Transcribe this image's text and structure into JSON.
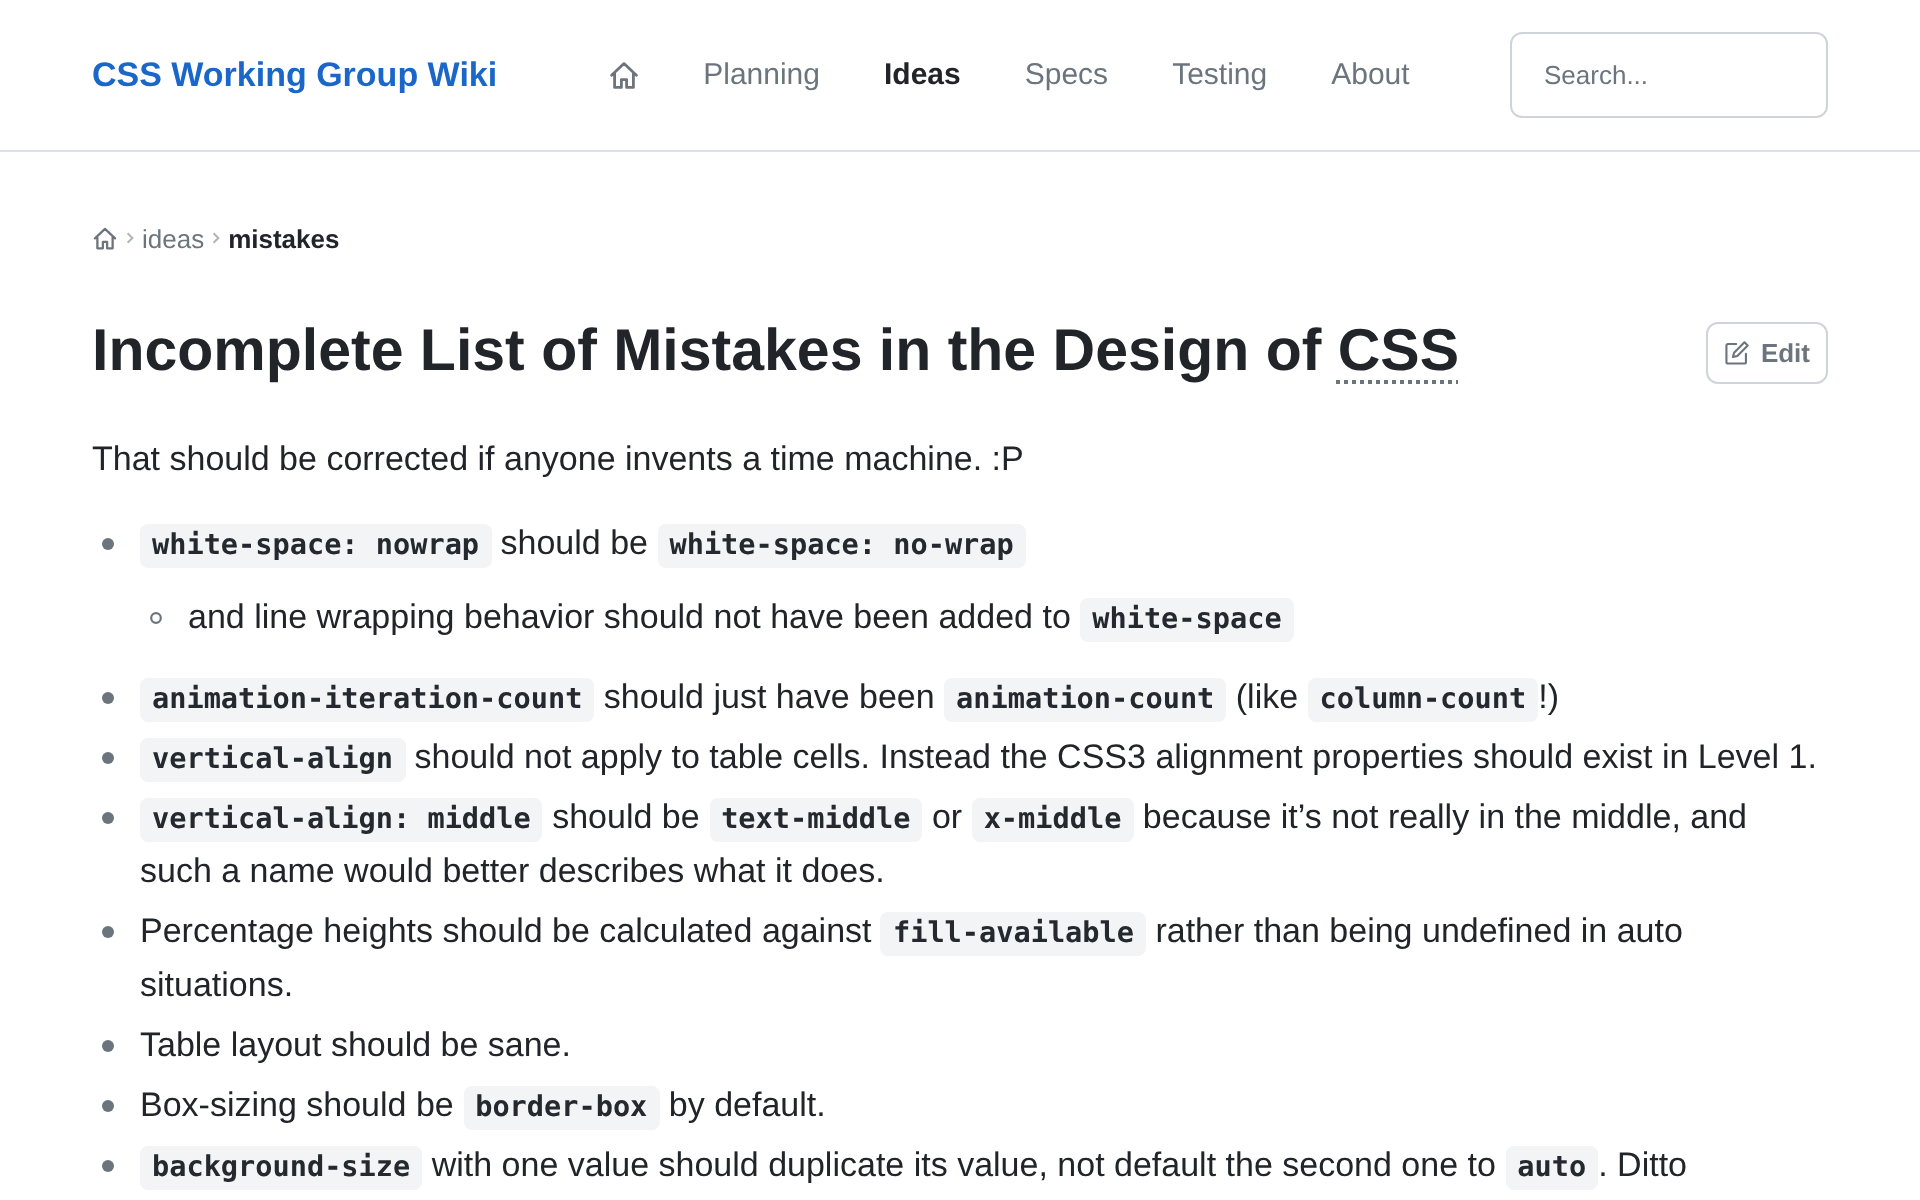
{
  "header": {
    "logo": "CSS Working Group Wiki",
    "nav": [
      {
        "kind": "icon",
        "selected": false
      },
      {
        "kind": "text",
        "label": "Planning",
        "selected": false
      },
      {
        "kind": "text",
        "label": "Ideas",
        "selected": true
      },
      {
        "kind": "text",
        "label": "Specs",
        "selected": false
      },
      {
        "kind": "text",
        "label": "Testing",
        "selected": false
      },
      {
        "kind": "text",
        "label": "About",
        "selected": false
      }
    ],
    "search": {
      "placeholder": "Search..."
    }
  },
  "breadcrumbs": [
    {
      "label": "ideas",
      "current": false
    },
    {
      "label": "mistakes",
      "current": true
    }
  ],
  "page": {
    "title": {
      "text": "Incomplete List of Mistakes in the Design of",
      "abbr": "CSS"
    },
    "edit_button": "Edit",
    "intro": "That should be corrected if anyone invents a time machine. :P",
    "items": [
      {
        "parts": [
          {
            "kind": "code",
            "text": "white-space: nowrap"
          },
          {
            "kind": "text",
            "text": " should be "
          },
          {
            "kind": "code",
            "text": "white-space: no-wrap"
          }
        ],
        "children": [
          {
            "parts": [
              {
                "kind": "text",
                "text": "and line wrapping behavior should not have been added to "
              },
              {
                "kind": "code",
                "text": "white-space"
              }
            ]
          }
        ]
      },
      {
        "parts": [
          {
            "kind": "code",
            "text": "animation-iteration-count"
          },
          {
            "kind": "text",
            "text": " should just have been "
          },
          {
            "kind": "code",
            "text": "animation-count"
          },
          {
            "kind": "text",
            "text": " (like "
          },
          {
            "kind": "code",
            "text": "column-count"
          },
          {
            "kind": "text",
            "text": "!)"
          }
        ]
      },
      {
        "parts": [
          {
            "kind": "code",
            "text": "vertical-align"
          },
          {
            "kind": "text",
            "text": " should not apply to table cells. Instead the CSS3 alignment properties should exist in Level 1."
          }
        ]
      },
      {
        "parts": [
          {
            "kind": "code",
            "text": "vertical-align: middle"
          },
          {
            "kind": "text",
            "text": " should be "
          },
          {
            "kind": "code",
            "text": "text-middle"
          },
          {
            "kind": "text",
            "text": " or "
          },
          {
            "kind": "code",
            "text": "x-middle"
          },
          {
            "kind": "text",
            "text": " because it’s not really in the middle, and such a name would better describes what it does."
          }
        ]
      },
      {
        "parts": [
          {
            "kind": "text",
            "text": "Percentage heights should be calculated against "
          },
          {
            "kind": "code",
            "text": "fill-available"
          },
          {
            "kind": "text",
            "text": " rather than being undefined in auto situations."
          }
        ]
      },
      {
        "parts": [
          {
            "kind": "text",
            "text": "Table layout should be sane."
          }
        ]
      },
      {
        "parts": [
          {
            "kind": "text",
            "text": "Box-sizing should be "
          },
          {
            "kind": "code",
            "text": "border-box"
          },
          {
            "kind": "text",
            "text": " by default."
          }
        ]
      },
      {
        "parts": [
          {
            "kind": "code",
            "text": "background-size"
          },
          {
            "kind": "text",
            "text": " with one value should duplicate its value, not default the second one to "
          },
          {
            "kind": "code",
            "text": "auto"
          },
          {
            "kind": "text",
            "text": ". Ditto"
          }
        ]
      }
    ]
  }
}
